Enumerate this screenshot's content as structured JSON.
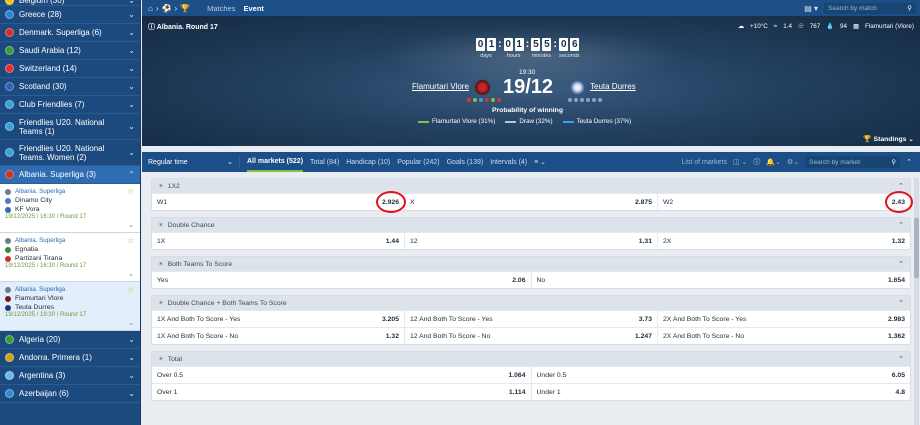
{
  "topnav": {
    "matches_tab": "Matches",
    "event_tab": "Event",
    "search_placeholder": "Search by match"
  },
  "sidebar": {
    "countries_top": [
      {
        "label": "Belgium (30)",
        "color": "#f1c40f"
      },
      {
        "label": "Greece (28)",
        "color": "#2f7fd8"
      },
      {
        "label": "Denmark. Superliga (6)",
        "color": "#d72c2c"
      },
      {
        "label": "Saudi Arabia (12)",
        "color": "#3b9a3b"
      },
      {
        "label": "Switzerland (14)",
        "color": "#e03131"
      },
      {
        "label": "Scotland (30)",
        "color": "#2b5fb8"
      },
      {
        "label": "Club Friendlies (7)",
        "color": "#3aa0d9"
      },
      {
        "label": "Friendlies U20. National Teams (1)",
        "color": "#3aa0d9"
      },
      {
        "label": "Friendlies U20. National Teams. Women (2)",
        "color": "#3aa0d9"
      }
    ],
    "selected_league": {
      "label": "Albania. Superliga (3)",
      "color": "#c0392b"
    },
    "matches": [
      {
        "league": "Albania. Superliga",
        "team1": "Dinamo City",
        "team2": "KF Vora",
        "time": "19/12/2025 / 16:30 / Round 17",
        "c1": "#4a7cc1",
        "c2": "#2e6db1"
      },
      {
        "league": "Albania. Superliga",
        "team1": "Egnatia",
        "team2": "Partizani Tirana",
        "time": "19/12/2025 / 16:30 / Round 17",
        "c1": "#2f8f3f",
        "c2": "#c0392b"
      },
      {
        "league": "Albania. Superliga",
        "team1": "Flamurtari Vlore",
        "team2": "Teuta Durres",
        "time": "19/12/2025 / 19:30 / Round 17",
        "c1": "#7a1a1a",
        "c2": "#1d3b6e"
      }
    ],
    "countries_bottom": [
      {
        "label": "Algeria (20)",
        "color": "#3b9a3b"
      },
      {
        "label": "Andorra. Primera (1)",
        "color": "#d4a017"
      },
      {
        "label": "Argentina (3)",
        "color": "#6bb7e8"
      },
      {
        "label": "Azerbaijan (6)",
        "color": "#2e8cd6"
      }
    ]
  },
  "hero": {
    "title": "Albania. Round 17",
    "weather_temp": "+10°C",
    "wind": "1.4",
    "pressure": "767",
    "humidity": "94",
    "venue": "Flamurtari (Vlore)",
    "countdown": {
      "days": [
        "0",
        "1"
      ],
      "hours": [
        "0",
        "1"
      ],
      "minutes": [
        "5",
        "5"
      ],
      "seconds": [
        "0",
        "6"
      ],
      "days_label": "days",
      "hours_label": "hours",
      "minutes_label": "minutes",
      "seconds_label": "seconds"
    },
    "kickoff_time": "19:30",
    "score": "19/12",
    "team1": "Flamurtari Vlore",
    "team2": "Teuta Durres",
    "team1_form": [
      "#e03131",
      "#7fc242",
      "#3aa0d9",
      "#e03131",
      "#7fc242",
      "#e03131"
    ],
    "team2_form": [
      "#8fa3b8",
      "#8fa3b8",
      "#8fa3b8",
      "#8fa3b8",
      "#8fa3b8",
      "#8fa3b8"
    ],
    "probability_title": "Probability of winning",
    "prob_legend": [
      {
        "label": "Flamurtari Vlore (31%)",
        "color": "#7fc242"
      },
      {
        "label": "Draw (32%)",
        "color": "#b9c6d6"
      },
      {
        "label": "Teuta Durres (37%)",
        "color": "#3aa0e8"
      }
    ],
    "standings": "Standings"
  },
  "marketbar": {
    "period": "Regular time",
    "tabs": [
      "All markets (522)",
      "Total (84)",
      "Handicap (10)",
      "Popular (242)",
      "Goals (139)",
      "Intervals (4)"
    ],
    "list_of_markets": "List of markets",
    "search_placeholder": "Search by market"
  },
  "markets": [
    {
      "title": "1X2",
      "rows": [
        [
          {
            "n": "W1",
            "v": "2.926"
          },
          {
            "n": "X",
            "v": "2.875"
          },
          {
            "n": "W2",
            "v": "2.43"
          }
        ]
      ]
    },
    {
      "title": "Double Chance",
      "rows": [
        [
          {
            "n": "1X",
            "v": "1.44"
          },
          {
            "n": "12",
            "v": "1.31"
          },
          {
            "n": "2X",
            "v": "1.32"
          }
        ]
      ]
    },
    {
      "title": "Both Teams To Score",
      "rows": [
        [
          {
            "n": "Yes",
            "v": "2.06"
          },
          {
            "n": "No",
            "v": "1.654"
          }
        ]
      ]
    },
    {
      "title": "Double Chance + Both Teams To Score",
      "rows": [
        [
          {
            "n": "1X And Both To Score - Yes",
            "v": "3.205"
          },
          {
            "n": "12 And Both To Score - Yes",
            "v": "3.73"
          },
          {
            "n": "2X And Both To Score - Yes",
            "v": "2.983"
          }
        ],
        [
          {
            "n": "1X And Both To Score - No",
            "v": "1.32"
          },
          {
            "n": "12 And Both To Score - No",
            "v": "1.247"
          },
          {
            "n": "2X And Both To Score - No",
            "v": "1.362"
          }
        ]
      ]
    },
    {
      "title": "Total",
      "rows": [
        [
          {
            "n": "Over 0.5",
            "v": "1.064"
          },
          {
            "n": "Under 0.5",
            "v": "6.05"
          }
        ],
        [
          {
            "n": "Over 1",
            "v": "1.114"
          },
          {
            "n": "Under 1",
            "v": "4.8"
          }
        ]
      ]
    }
  ],
  "colors": {
    "accent": "#1c4f88",
    "highlight_circle": "#e3101a",
    "active_tab_underline": "#7fc242"
  }
}
